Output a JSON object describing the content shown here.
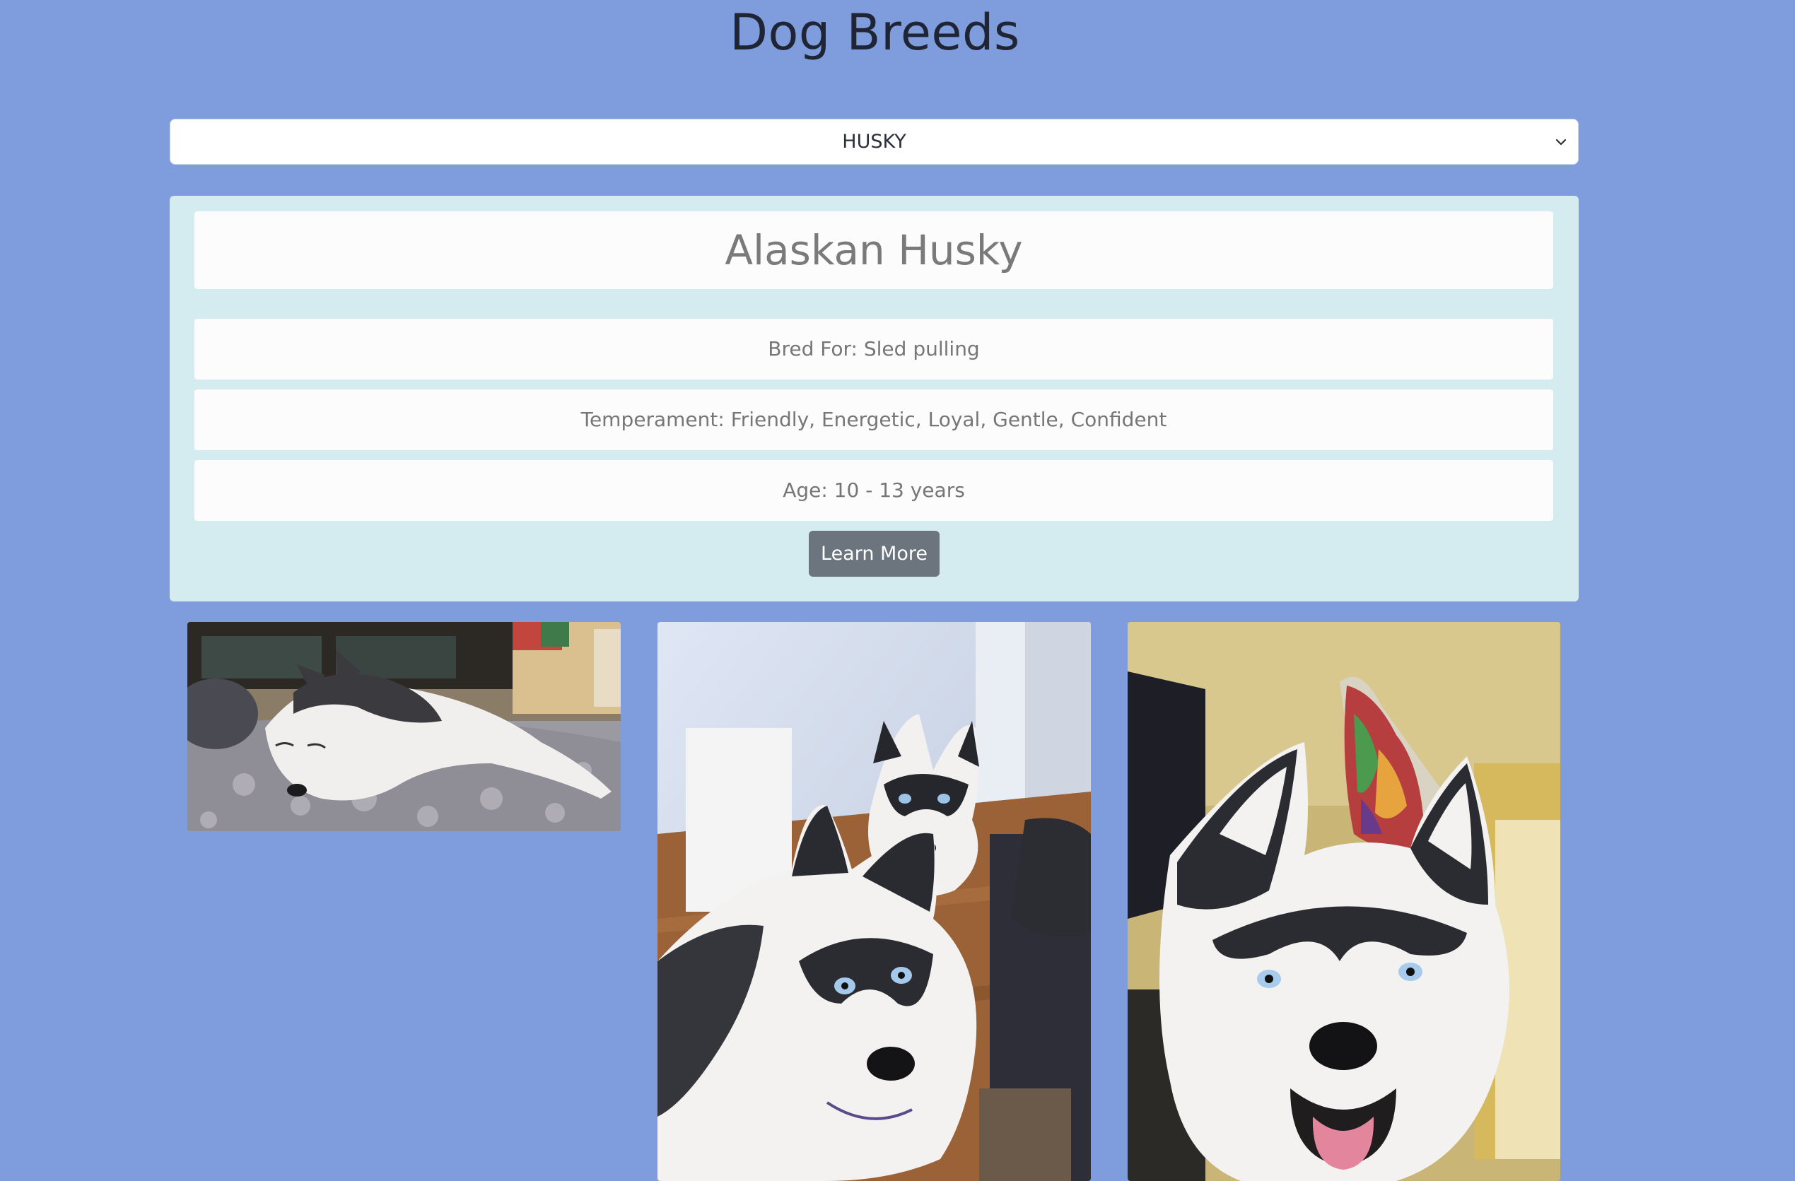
{
  "header": {
    "title": "Dog Breeds"
  },
  "breed_select": {
    "selected": "HUSKY",
    "chevron_icon": "chevron-down-icon"
  },
  "breed_card": {
    "name": "Alaskan Husky",
    "bred_for": "Bred For: Sled pulling",
    "temperament": "Temperament: Friendly, Energetic, Loyal, Gentle, Confident",
    "age": "Age: 10 - 13 years",
    "learn_more_label": "Learn More",
    "background_color": "#d4ebf0",
    "button_color": "#6c757d"
  },
  "gallery": {
    "images": [
      {
        "subject": "husky-sleeping-on-bed"
      },
      {
        "subject": "two-huskies-looking-up"
      },
      {
        "subject": "husky-smiling-closeup"
      }
    ]
  },
  "theme": {
    "page_background": "#7f9cdd"
  }
}
